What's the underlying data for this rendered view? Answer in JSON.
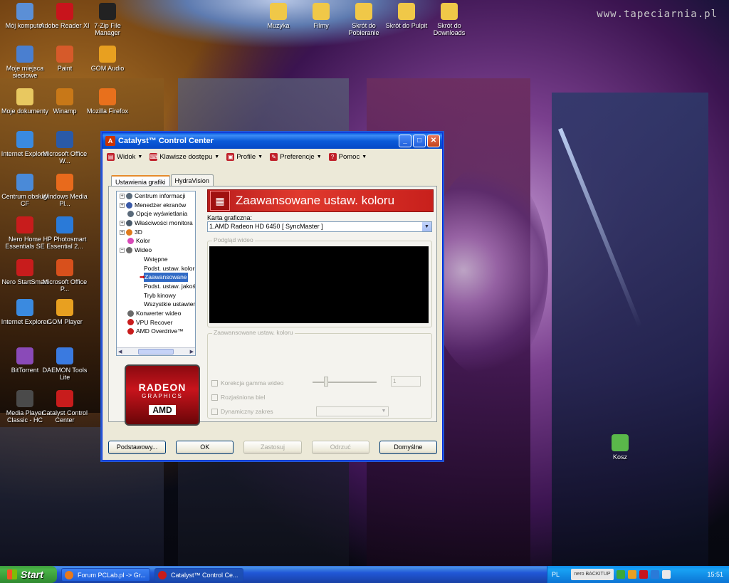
{
  "desktop": {
    "watermark": "www.tapeciarnia.pl",
    "icons": [
      {
        "label": "Mój komputer",
        "icon": "computer-icon",
        "color": "#5b8fd6"
      },
      {
        "label": "Adobe Reader XI",
        "icon": "pdf-icon",
        "color": "#c8141c"
      },
      {
        "label": "7-Zip File Manager",
        "icon": "zip-icon",
        "color": "#222222"
      },
      {
        "label": "Moje miejsca sieciowe",
        "icon": "network-icon",
        "color": "#4a7fd0"
      },
      {
        "label": "Paint",
        "icon": "paint-icon",
        "color": "#d65a2a"
      },
      {
        "label": "GOM Audio",
        "icon": "audio-icon",
        "color": "#e8a020"
      },
      {
        "label": "Moje dokumenty",
        "icon": "documents-icon",
        "color": "#e8c860"
      },
      {
        "label": "Winamp",
        "icon": "winamp-icon",
        "color": "#c87818"
      },
      {
        "label": "Mozilla Firefox",
        "icon": "firefox-icon",
        "color": "#e8701c"
      },
      {
        "label": "Internet Explorer",
        "icon": "ie-icon",
        "color": "#3a8ae0"
      },
      {
        "label": "Microsoft Office W...",
        "icon": "word-icon",
        "color": "#2a5aa8"
      },
      {
        "label": "Centrum obsługi CF",
        "icon": "support-icon",
        "color": "#4a8ad8"
      },
      {
        "label": "Windows Media Pl...",
        "icon": "media-player-icon",
        "color": "#e86a1c"
      },
      {
        "label": "Nero Home Essentials SE",
        "icon": "nero-icon",
        "color": "#c81c1c"
      },
      {
        "label": "HP Photosmart Essential 2...",
        "icon": "hp-icon",
        "color": "#2a7ad8"
      },
      {
        "label": "Nero StartSmart",
        "icon": "nero-start-icon",
        "color": "#c81c1c"
      },
      {
        "label": "Microsoft Office P...",
        "icon": "powerpoint-icon",
        "color": "#d8501c"
      },
      {
        "label": "Internet Explorer",
        "icon": "ie-icon",
        "color": "#3a8ae0"
      },
      {
        "label": "GOM Player",
        "icon": "gom-player-icon",
        "color": "#e8a020"
      },
      {
        "label": "BitTorrent",
        "icon": "bittorrent-icon",
        "color": "#8a4ab8"
      },
      {
        "label": "DAEMON Tools Lite",
        "icon": "daemon-tools-icon",
        "color": "#3a7ae0"
      },
      {
        "label": "Media Player Classic - HC",
        "icon": "mpc-icon",
        "color": "#4a4a4a"
      },
      {
        "label": "Catalyst Control Center",
        "icon": "catalyst-icon",
        "color": "#c81c1c"
      },
      {
        "label": "Muzyka",
        "icon": "folder-icon",
        "color": "#f0c848"
      },
      {
        "label": "Filmy",
        "icon": "folder-icon",
        "color": "#f0c848"
      },
      {
        "label": "Skrót do Pobieranie",
        "icon": "folder-icon",
        "color": "#f0c848"
      },
      {
        "label": "Skrót do Pulpit",
        "icon": "folder-icon",
        "color": "#f0c848"
      },
      {
        "label": "Skrót do Downloads",
        "icon": "folder-icon",
        "color": "#f0c848"
      },
      {
        "label": "Kosz",
        "icon": "recycle-bin-icon",
        "color": "#5ab84a"
      }
    ]
  },
  "window": {
    "title": "Catalyst™ Control Center",
    "menu": [
      {
        "label": "Widok"
      },
      {
        "label": "Klawisze dostępu"
      },
      {
        "label": "Profile"
      },
      {
        "label": "Preferencje"
      },
      {
        "label": "Pomoc"
      }
    ],
    "tabs": [
      "Ustawienia grafiki",
      "HydraVision"
    ],
    "tree": [
      {
        "label": "Centrum informacji",
        "exp": "+",
        "color": "#5a6a7a"
      },
      {
        "label": "Menedżer ekranów",
        "exp": "+",
        "color": "#3a5aa8"
      },
      {
        "label": "Opcje wyświetlania",
        "exp": "",
        "color": "#5a6a7a"
      },
      {
        "label": "Właściwości monitora",
        "exp": "+",
        "color": "#4a5a6a"
      },
      {
        "label": "3D",
        "exp": "+",
        "color": "#e07a1c"
      },
      {
        "label": "Kolor",
        "exp": "",
        "color": "#d84ab8"
      },
      {
        "label": "Wideo",
        "exp": "−",
        "color": "#6a6a6a"
      },
      {
        "label": "Wstępne",
        "exp": "",
        "color": "",
        "indent": 1
      },
      {
        "label": "Podst. ustaw. koloru",
        "exp": "",
        "color": "",
        "indent": 1
      },
      {
        "label": "Zaawansowane",
        "exp": "",
        "color": "",
        "indent": 1,
        "selected": true
      },
      {
        "label": "Podst. ustaw. jakości",
        "exp": "",
        "color": "",
        "indent": 1
      },
      {
        "label": "Tryb kinowy",
        "exp": "",
        "color": "",
        "indent": 1
      },
      {
        "label": "Wszystkie ustawienia",
        "exp": "",
        "color": "",
        "indent": 1
      },
      {
        "label": "Konwerter wideo",
        "exp": "",
        "color": "#6a6a6a"
      },
      {
        "label": "VPU Recover",
        "exp": "",
        "color": "#c81c1c"
      },
      {
        "label": "AMD Overdrive™",
        "exp": "",
        "color": "#c81c1c"
      }
    ],
    "logo": {
      "line1": "RADEON",
      "line2": "GRAPHICS",
      "line3": "AMD"
    },
    "header_title": "Zaawansowane ustaw. koloru",
    "card_label": "Karta graficzna:",
    "card_value": "1.AMD Radeon HD 6450 [ SyncMaster ]",
    "preview_group": "Podgląd wideo",
    "adv_group": "Zaawansowane ustaw. koloru",
    "checks": [
      "Korekcja gamma wideo",
      "Rozjaśniona biel",
      "Dynamiczny zakres"
    ],
    "spin_value": "1",
    "buttons": [
      "Podstawowy...",
      "OK",
      "Zastosuj",
      "Odrzuć",
      "Domyślne"
    ]
  },
  "taskbar": {
    "start": "Start",
    "tasks": [
      "Forum PCLab.pl -> Gr...",
      "Catalyst™ Control Ce..."
    ],
    "lang": "PL",
    "nero": "nero BACKITUP",
    "clock": "15:51"
  }
}
